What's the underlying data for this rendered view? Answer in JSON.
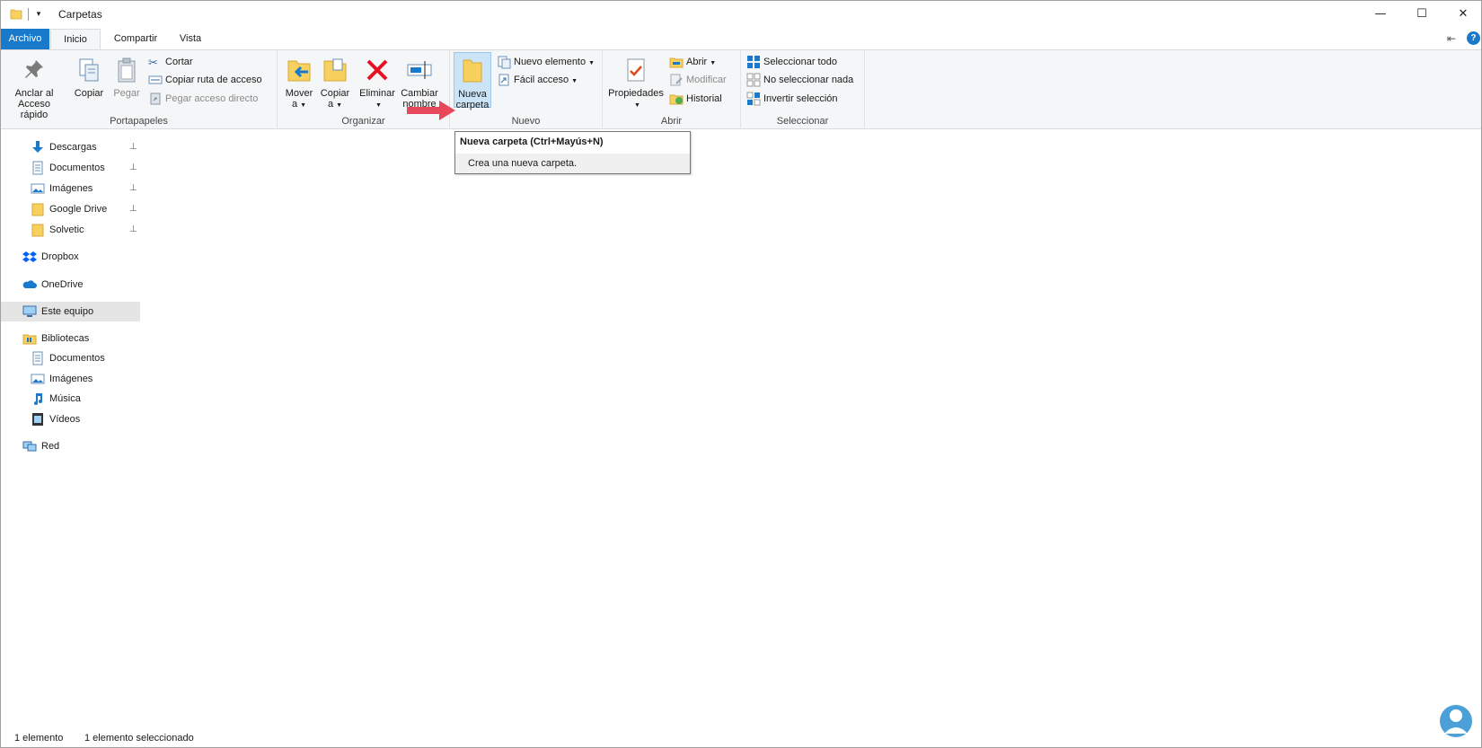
{
  "window": {
    "title": "Carpetas",
    "controls": {
      "minimize": "—",
      "maximize": "☐",
      "close": "✕"
    }
  },
  "ribbon_tabs": [
    "Archivo",
    "Inicio",
    "Compartir",
    "Vista"
  ],
  "ribbon_right": {
    "pin_glyph": "⇤",
    "help_glyph": "?"
  },
  "ribbon": {
    "portapapeles": {
      "label": "Portapapeles",
      "anclar": "Anclar al\nAcceso rápido",
      "anclar_line1": "Anclar al",
      "anclar_line2": "Acceso rápido",
      "copiar": "Copiar",
      "pegar": "Pegar",
      "cortar": "Cortar",
      "copiar_ruta": "Copiar ruta de acceso",
      "pegar_acceso": "Pegar acceso directo"
    },
    "organizar": {
      "label": "Organizar",
      "mover_line1": "Mover",
      "mover_line2": "a",
      "copiar_line1": "Copiar",
      "copiar_line2": "a",
      "eliminar": "Eliminar",
      "cambiar_line1": "Cambiar",
      "cambiar_line2": "nombre"
    },
    "nuevo": {
      "label": "Nuevo",
      "nueva_line1": "Nueva",
      "nueva_line2": "carpeta",
      "nuevo_elemento": "Nuevo elemento",
      "facil_acceso": "Fácil acceso"
    },
    "abrir": {
      "label": "Abrir",
      "propiedades": "Propiedades",
      "abrir": "Abrir",
      "modificar": "Modificar",
      "historial": "Historial"
    },
    "seleccionar": {
      "label": "Seleccionar",
      "todo": "Seleccionar todo",
      "nada": "No seleccionar nada",
      "invertir": "Invertir selección"
    }
  },
  "tooltip": {
    "title": "Nueva carpeta (Ctrl+Mayús+N)",
    "body": "Crea una nueva carpeta."
  },
  "nav": {
    "quick_access": [
      {
        "label": "Descargas",
        "icon": "download-icon",
        "pinned": true
      },
      {
        "label": "Documentos",
        "icon": "document-icon",
        "pinned": true
      },
      {
        "label": "Imágenes",
        "icon": "pictures-icon",
        "pinned": true
      },
      {
        "label": "Google Drive",
        "icon": "folder-icon",
        "pinned": true
      },
      {
        "label": "Solvetic",
        "icon": "folder-icon",
        "pinned": true
      }
    ],
    "dropbox": "Dropbox",
    "onedrive": "OneDrive",
    "este_equipo": "Este equipo",
    "bibliotecas": "Bibliotecas",
    "libraries": [
      {
        "label": "Documentos",
        "icon": "document-icon"
      },
      {
        "label": "Imágenes",
        "icon": "pictures-icon"
      },
      {
        "label": "Música",
        "icon": "music-icon"
      },
      {
        "label": "Vídeos",
        "icon": "video-icon"
      }
    ],
    "red": "Red",
    "pin_glyph": "📌"
  },
  "status": {
    "count": "1 elemento",
    "selected": "1 elemento seleccionado"
  },
  "colors": {
    "accent": "#1979ca",
    "folder": "#f7d05e",
    "delete_red": "#e81123",
    "arrow": "#e8495a"
  }
}
